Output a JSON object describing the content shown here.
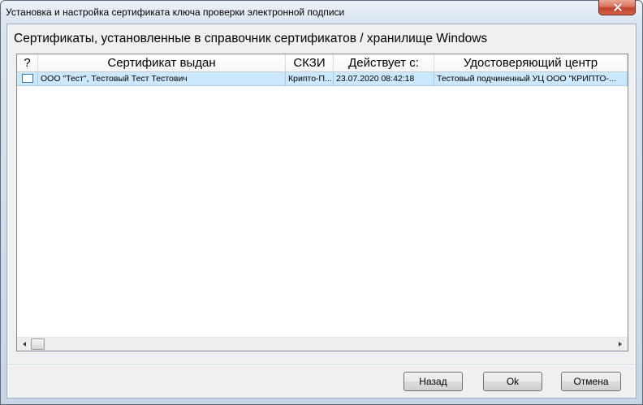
{
  "window": {
    "title": "Установка и настройка сертификата ключа проверки электронной подписи",
    "close_icon": "close-icon"
  },
  "heading": "Сертификаты, установленные в справочник сертификатов / хранилище Windows",
  "table": {
    "columns": [
      "?",
      "Сертификат выдан",
      "СКЗИ",
      "Действует с:",
      "Удостоверяющий центр"
    ],
    "rows": [
      {
        "checked": false,
        "selected": true,
        "issued_to": "ООО \"Тест\", Тестовый Тест Тестович",
        "csp": "Крипто-П...",
        "valid_from": "23.07.2020 08:42:18",
        "issuer": "Тестовый подчиненный УЦ ООО \"КРИПТО-..."
      }
    ],
    "scrollbar": {
      "left_icon": "scroll-left-icon",
      "right_icon": "scroll-right-icon"
    }
  },
  "buttons": {
    "back": "Назад",
    "ok": "Ok",
    "cancel": "Отмена"
  },
  "colors": {
    "selected_row": "#cce8ff",
    "dialog_bg": "#f0f0f0",
    "close_button": "#c2432f"
  }
}
